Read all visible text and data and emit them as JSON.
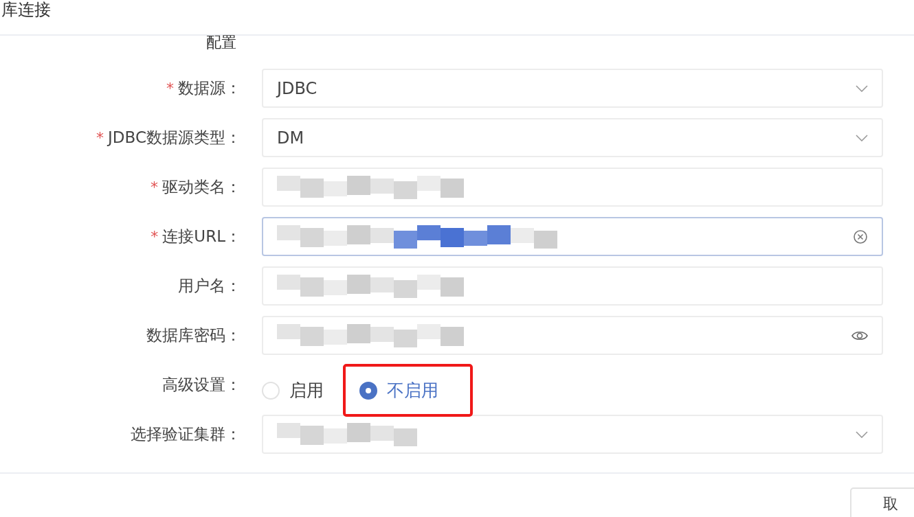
{
  "dialog": {
    "title": "库连接"
  },
  "section": {
    "title": "配置"
  },
  "fields": [
    {
      "kind": "select",
      "label": "数据源：",
      "required_mark": "*",
      "value": "JDBC",
      "focused": false
    },
    {
      "kind": "select",
      "label": "JDBC数据源类型：",
      "required_mark": "*",
      "value": "DM",
      "focused": false
    },
    {
      "kind": "input",
      "label": "驱动类名：",
      "required_mark": "*",
      "focused": false
    },
    {
      "kind": "clearable",
      "label": "连接URL：",
      "required_mark": "*",
      "focused": true
    },
    {
      "kind": "input",
      "label": "用户名：",
      "focused": false
    },
    {
      "kind": "password",
      "label": "数据库密码：",
      "focused": false
    },
    {
      "kind": "radio",
      "label": "高级设置：",
      "options": [
        {
          "label": "启用",
          "selected": false,
          "highlighted": false
        },
        {
          "label": "不启用",
          "selected": true,
          "highlighted": true
        }
      ]
    },
    {
      "kind": "select",
      "label": "选择验证集群：",
      "focused": false
    }
  ],
  "buttons": [
    {
      "label": "取"
    }
  ]
}
